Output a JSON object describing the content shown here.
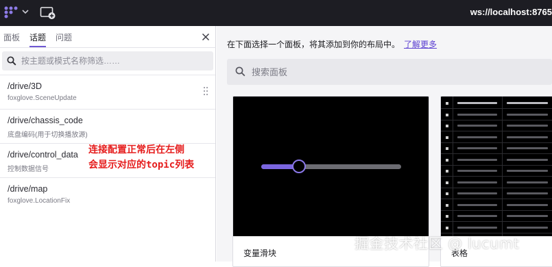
{
  "app": {
    "connection": "ws://localhost:8765",
    "colors": {
      "accent": "#6f58d3",
      "topbar": "#1d1d23",
      "annotation": "#e51c1c"
    }
  },
  "sidebar": {
    "tabs": [
      {
        "label": "面板",
        "active": false
      },
      {
        "label": "话题",
        "active": true
      },
      {
        "label": "问题",
        "active": false
      }
    ],
    "filter_placeholder": "按主题或模式名称筛选……",
    "topics": [
      {
        "name": "/drive/3D",
        "schema": "foxglove.SceneUpdate"
      },
      {
        "name": "/drive/chassis_code",
        "schema": "底盘编码(用于切换播放源)"
      },
      {
        "name": "/drive/control_data",
        "schema": "控制数据信号"
      },
      {
        "name": "/drive/map",
        "schema": "foxglove.LocationFix"
      }
    ],
    "annotation_lines": [
      "连接配置正常后在左侧",
      "会显示对应的topic列表"
    ]
  },
  "main": {
    "intro_text": "在下面选择一个面板，将其添加到你的布局中。",
    "learn_more": "了解更多",
    "search_placeholder": "搜索面板",
    "cards": [
      {
        "label": "变量滑块",
        "slider_value": 0.27
      },
      {
        "label": "表格"
      }
    ]
  },
  "watermark": "掘金技术社区 @ lucumt",
  "icons": {
    "logo": "foxglove-logo-icon",
    "chevron": "chevron-down-icon",
    "layout": "add-window-icon",
    "close": "close-icon",
    "search": "search-icon",
    "drag": "drag-handle-icon"
  }
}
